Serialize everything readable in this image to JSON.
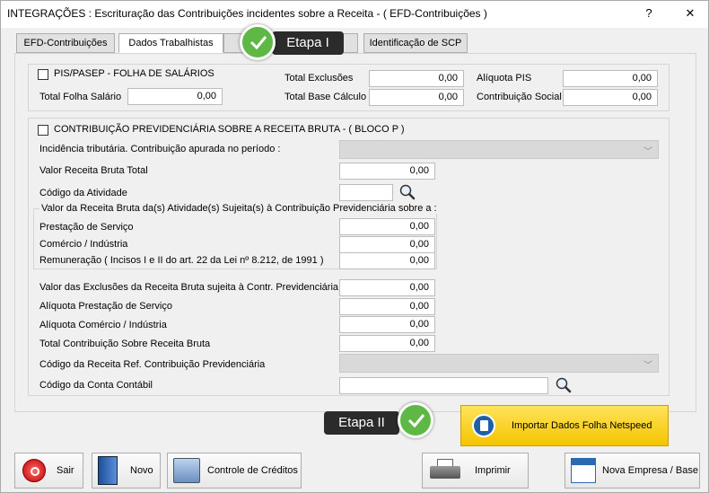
{
  "window": {
    "title": "INTEGRAÇÕES : Escrituração das Contribuições incidentes sobre a Receita - ( EFD-Contribuições )",
    "help_label": "?",
    "close_label": "✕"
  },
  "tabs": [
    {
      "label": "EFD-Contribuições"
    },
    {
      "label": "Dados Trabalhistas"
    },
    {
      "label": "Identificação de SCP"
    }
  ],
  "annotations": {
    "etapa1": "Etapa I",
    "etapa2": "Etapa II"
  },
  "pis": {
    "checkbox_label": "PIS/PASEP - FOLHA DE SALÁRIOS",
    "total_folha_label": "Total Folha Salário",
    "total_folha_value": "0,00",
    "total_exclusoes_label": "Total Exclusões",
    "total_exclusoes_value": "0,00",
    "total_base_label": "Total Base Cálculo",
    "total_base_value": "0,00",
    "aliquota_label": "Alíquota PIS",
    "aliquota_value": "0,00",
    "contribuicao_label": "Contribuição Social",
    "contribuicao_value": "0,00"
  },
  "cprb": {
    "checkbox_label": "CONTRIBUIÇÃO PREVIDENCIÁRIA SOBRE A RECEITA BRUTA  -  ( BLOCO P )",
    "incidencia_label": "Incidência tributária. Contribuição apurada no período :",
    "incidencia_value": "",
    "receita_total_label": "Valor Receita Bruta Total",
    "receita_total_value": "0,00",
    "codigo_atividade_label": "Código da Atividade",
    "codigo_atividade_value": "",
    "group_title": "Valor da Receita Bruta da(s) Atividade(s) Sujeita(s) à Contribuição Previdenciária sobre a :",
    "prestacao_label": "Prestação de Serviço",
    "prestacao_value": "0,00",
    "comercio_label": "Comércio / Indústria",
    "comercio_value": "0,00",
    "remuneracao_label": "Remuneração ( Incisos I e II do art. 22 da Lei nº 8.212, de 1991 )",
    "remuneracao_value": "0,00",
    "exclusoes_label": "Valor das Exclusões da Receita Bruta  sujeita à Contr. Previdenciária",
    "exclusoes_value": "0,00",
    "aliq_prestacao_label": "Alíquota Prestação de Serviço",
    "aliq_prestacao_value": "0,00",
    "aliq_comercio_label": "Alíquota Comércio / Indústria",
    "aliq_comercio_value": "0,00",
    "total_contrib_label": "Total Contribuição Sobre Receita Bruta",
    "total_contrib_value": "0,00",
    "codigo_receita_label": "Código da Receita Ref. Contribuição Previdenciária",
    "codigo_receita_value": "",
    "conta_contabil_label": "Código da Conta Contábil",
    "conta_contabil_value": ""
  },
  "import_button": {
    "label": "Importar Dados Folha Netspeed"
  },
  "footer": {
    "sair": "Sair",
    "novo": "Novo",
    "controle": "Controle de Créditos",
    "imprimir": "Imprimir",
    "nova_empresa": "Nova Empresa / Base"
  },
  "colors": {
    "accent_green": "#5fb846",
    "import_yellow": "#f5c400",
    "badge_dark": "#2b2b2b"
  }
}
